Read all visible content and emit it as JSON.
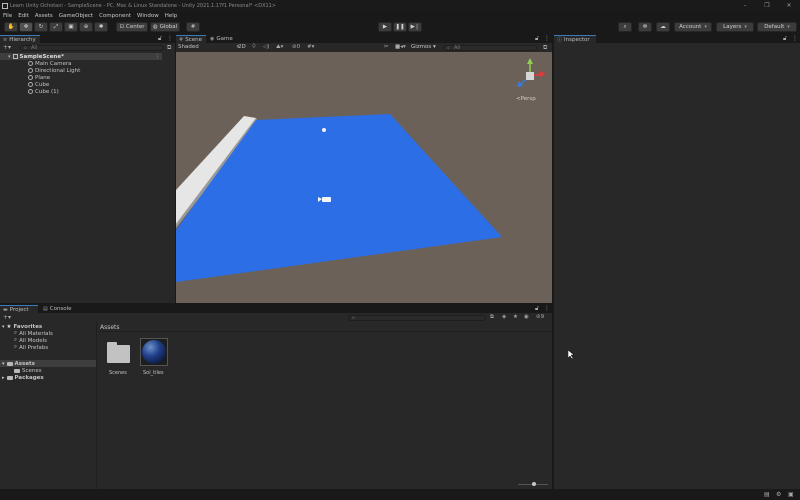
{
  "window": {
    "title": "Learn Unity Ochotani - SampleScene - PC, Mac & Linux Standalone - Unity 2021.1.17f1 Personal* <DX11>",
    "minimize": "–",
    "maximize": "❐",
    "close": "✕"
  },
  "menu": [
    "File",
    "Edit",
    "Assets",
    "GameObject",
    "Component",
    "Window",
    "Help"
  ],
  "toolbar": {
    "center_label": "Center",
    "global_label": "Global",
    "account_label": "Account",
    "layers_label": "Layers",
    "layout_label": "Default"
  },
  "hierarchy": {
    "tab_label": "Hierarchy",
    "search_placeholder": "All",
    "scene_name": "SampleScene*",
    "items": [
      "Main Camera",
      "Directional Light",
      "Plane",
      "Cube",
      "Cube (1)"
    ]
  },
  "scene": {
    "scene_tab": "Scene",
    "game_tab": "Game",
    "shading_mode": "Shaded",
    "mode_2d": "2D",
    "gizmos_label": "Gizmos",
    "search_placeholder": "All",
    "gizmo_view_label": "<Persp",
    "counter": "0"
  },
  "inspector": {
    "tab_label": "Inspector"
  },
  "project": {
    "project_tab": "Project",
    "console_tab": "Console",
    "favorites_label": "Favorites",
    "favorites": [
      "All Materials",
      "All Models",
      "All Prefabs"
    ],
    "assets_label": "Assets",
    "assets_children": [
      "Scenes"
    ],
    "packages_label": "Packages",
    "breadcrumb": "Assets",
    "hidden_count": "9",
    "assets": [
      {
        "name": "Scenes",
        "kind": "folder"
      },
      {
        "name": "Sol_tiles",
        "kind": "material"
      }
    ]
  },
  "colors": {
    "plane": "#2b6ee6",
    "sky": "#6b6158",
    "accent": "#3a79bb"
  }
}
